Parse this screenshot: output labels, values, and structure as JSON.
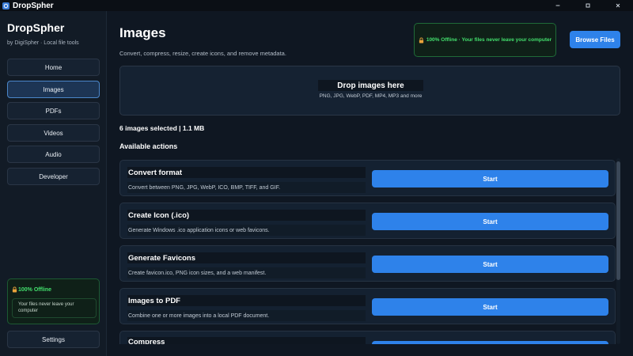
{
  "window": {
    "title": "DropSpher",
    "controls": {
      "minimize": "minimize-icon",
      "maximize": "maximize-icon",
      "close": "close-icon"
    }
  },
  "sidebar": {
    "brand": "DropSpher",
    "subtitle": "by DigiSpher · Local file tools",
    "items": [
      {
        "label": "Home",
        "active": false
      },
      {
        "label": "Images",
        "active": true
      },
      {
        "label": "PDFs",
        "active": false
      },
      {
        "label": "Videos",
        "active": false
      },
      {
        "label": "Audio",
        "active": false
      },
      {
        "label": "Developer",
        "active": false
      }
    ],
    "offline_card": {
      "title": "100% Offline",
      "note": "Your files never leave your computer"
    },
    "settings_label": "Settings"
  },
  "header": {
    "title": "Images",
    "subtitle": "Convert, compress, resize, create icons, and remove metadata.",
    "offline_badge": "100% Offline · Your files never leave your computer",
    "browse_label": "Browse Files"
  },
  "dropzone": {
    "title": "Drop images here",
    "formats": "PNG, JPG, WebP, PDF, MP4, MP3 and more"
  },
  "selection": {
    "summary": "6 images selected | 1.1 MB"
  },
  "actions_heading": "Available actions",
  "actions": [
    {
      "name": "Convert format",
      "description": "Convert between PNG, JPG, WebP, ICO, BMP, TIFF, and GIF.",
      "button": "Start"
    },
    {
      "name": "Create Icon (.ico)",
      "description": "Generate Windows .ico application icons or web favicons.",
      "button": "Start"
    },
    {
      "name": "Generate Favicons",
      "description": "Create favicon.ico, PNG icon sizes, and a web manifest.",
      "button": "Start"
    },
    {
      "name": "Images to PDF",
      "description": "Combine one or more images into a local PDF document.",
      "button": "Start"
    },
    {
      "name": "Compress",
      "description": "",
      "button": ""
    }
  ],
  "colors": {
    "accent": "#2e82ea",
    "offline_green": "#43e06d",
    "background": "#0f1722"
  }
}
